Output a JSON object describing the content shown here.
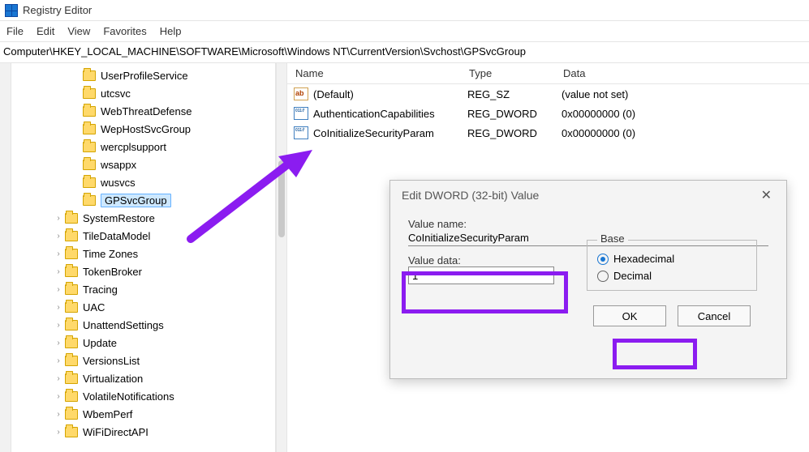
{
  "title": "Registry Editor",
  "menu": {
    "file": "File",
    "edit": "Edit",
    "view": "View",
    "favorites": "Favorites",
    "help": "Help"
  },
  "address": "Computer\\HKEY_LOCAL_MACHINE\\SOFTWARE\\Microsoft\\Windows NT\\CurrentVersion\\Svchost\\GPSvcGroup",
  "tree_group1": [
    "UserProfileService",
    "utcsvc",
    "WebThreatDefense",
    "WepHostSvcGroup",
    "wercplsupport",
    "wsappx",
    "wusvcs"
  ],
  "tree_selected": "GPSvcGroup",
  "tree_group2": [
    "SystemRestore",
    "TileDataModel",
    "Time Zones",
    "TokenBroker",
    "Tracing",
    "UAC",
    "UnattendSettings",
    "Update",
    "VersionsList",
    "Virtualization",
    "VolatileNotifications",
    "WbemPerf",
    "WiFiDirectAPI"
  ],
  "list_header": {
    "name": "Name",
    "type": "Type",
    "data": "Data"
  },
  "rows": [
    {
      "icon": "str",
      "name": "(Default)",
      "type": "REG_SZ",
      "data": "(value not set)"
    },
    {
      "icon": "bin",
      "name": "AuthenticationCapabilities",
      "type": "REG_DWORD",
      "data": "0x00000000 (0)"
    },
    {
      "icon": "bin",
      "name": "CoInitializeSecurityParam",
      "type": "REG_DWORD",
      "data": "0x00000000 (0)"
    }
  ],
  "dialog": {
    "title": "Edit DWORD (32-bit) Value",
    "value_name_label": "Value name:",
    "value_name": "CoInitializeSecurityParam",
    "value_data_label": "Value data:",
    "value_data": "1",
    "base_label": "Base",
    "hex": "Hexadecimal",
    "dec": "Decimal",
    "ok": "OK",
    "cancel": "Cancel"
  }
}
